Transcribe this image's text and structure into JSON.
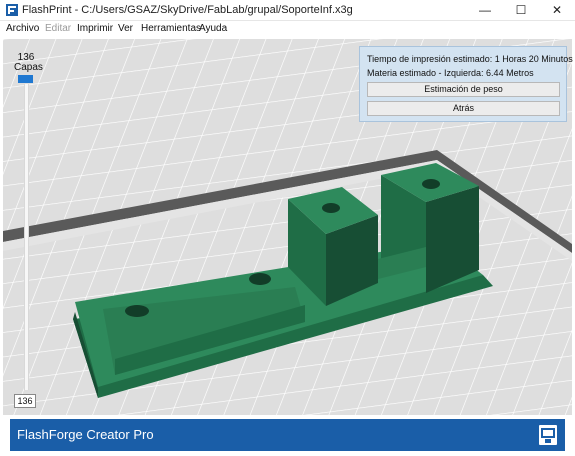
{
  "window": {
    "title": "FlashPrint - C:/Users/GSAZ/SkyDrive/FabLab/grupal/SoporteInf.x3g",
    "minimize_glyph": "—",
    "maximize_glyph": "☐",
    "close_glyph": "✕"
  },
  "menu": {
    "items": [
      "Archivo",
      "Editar",
      "Imprimir",
      "Ver",
      "Herramientas",
      "Ayuda"
    ],
    "disabled": [
      "Editar"
    ]
  },
  "layers": {
    "current": "136",
    "label": "Capas",
    "input_value": "136",
    "fraction": 1.0
  },
  "info_panel": {
    "print_time": "Tiempo de impresión estimado: 1 Horas 20 Minutos",
    "material": "Materia estimado - Izquierda: 6.44 Metros",
    "weight_button": "Estimación de peso",
    "back_button": "Atrás"
  },
  "footer": {
    "printer_name": "FlashForge Creator Pro"
  },
  "colors": {
    "model_top": "#2e8a5c",
    "model_side": "#1f6d46",
    "model_dark": "#174e34",
    "platform_bg": "#d8d8d8",
    "platform_border": "#5a5a5a",
    "accent": "#1a5ea8",
    "slider": "#1f78d1"
  },
  "icons": {
    "app": "flashprint-app-icon",
    "footer": "printer-status-icon"
  }
}
